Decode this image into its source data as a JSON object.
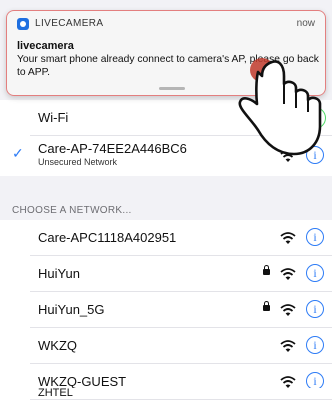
{
  "notification": {
    "app_name": "LIVECAMERA",
    "time": "now",
    "title": "livecamera",
    "message": "Your smart phone already connect to camera's AP, please go back to APP."
  },
  "wifi": {
    "label": "Wi-Fi",
    "toggle_on": true,
    "connected": {
      "ssid": "Care-AP-74EE2A446BC6",
      "subtitle": "Unsecured Network"
    },
    "section_header": "CHOOSE A NETWORK...",
    "networks": [
      {
        "ssid": "Care-APC1118A402951",
        "locked": false
      },
      {
        "ssid": "HuiYun",
        "locked": true
      },
      {
        "ssid": "HuiYun_5G",
        "locked": true
      },
      {
        "ssid": "WKZQ",
        "locked": false
      },
      {
        "ssid": "WKZQ-GUEST",
        "locked": false
      },
      {
        "ssid": "ZHTEL",
        "locked": true
      }
    ]
  },
  "icons": {
    "app": "camera-app-icon",
    "check": "checkmark-icon",
    "wifi": "wifi-signal-icon",
    "info": "info-icon",
    "lock": "lock-icon",
    "hand": "tapping-hand-icon"
  },
  "colors": {
    "accent": "#2e7cf6",
    "toggle": "#4cd964",
    "banner_border": "#e37f7f",
    "tap_marker": "#c0392b"
  }
}
